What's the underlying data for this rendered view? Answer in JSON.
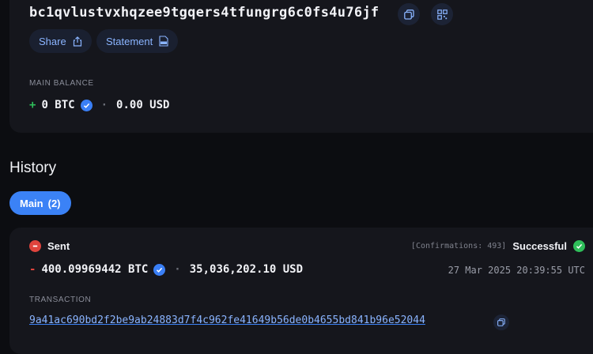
{
  "wallet": {
    "address": "bc1qvlustvxhqzee9tgqers4tfungrg6c0fs4u76jf",
    "share_label": "Share",
    "statement_label": "Statement",
    "balance_label": "MAIN BALANCE",
    "balance_sign": "+",
    "balance_btc": "0 BTC",
    "balance_usd": "0.00 USD"
  },
  "history": {
    "title": "History",
    "tab_label": "Main",
    "tab_count": "(2)"
  },
  "transaction": {
    "direction": "Sent",
    "confirmations": "[Confirmations: 493]",
    "status": "Successful",
    "amount_sign": "-",
    "amount_btc": "400.09969442 BTC",
    "amount_usd": "35,036,202.10 USD",
    "date": "27 Mar 2025 20:39:55 UTC",
    "tx_label": "TRANSACTION",
    "tx_hash": "9a41ac690bd2f2be9ab24883d7f4c962fe41649b56de0b4655bd841b96e52044"
  },
  "colors": {
    "accent": "#3b82f6",
    "success": "#2fbf5a",
    "danger": "#e0443d",
    "background": "#0c0d11",
    "card": "#15161c"
  }
}
